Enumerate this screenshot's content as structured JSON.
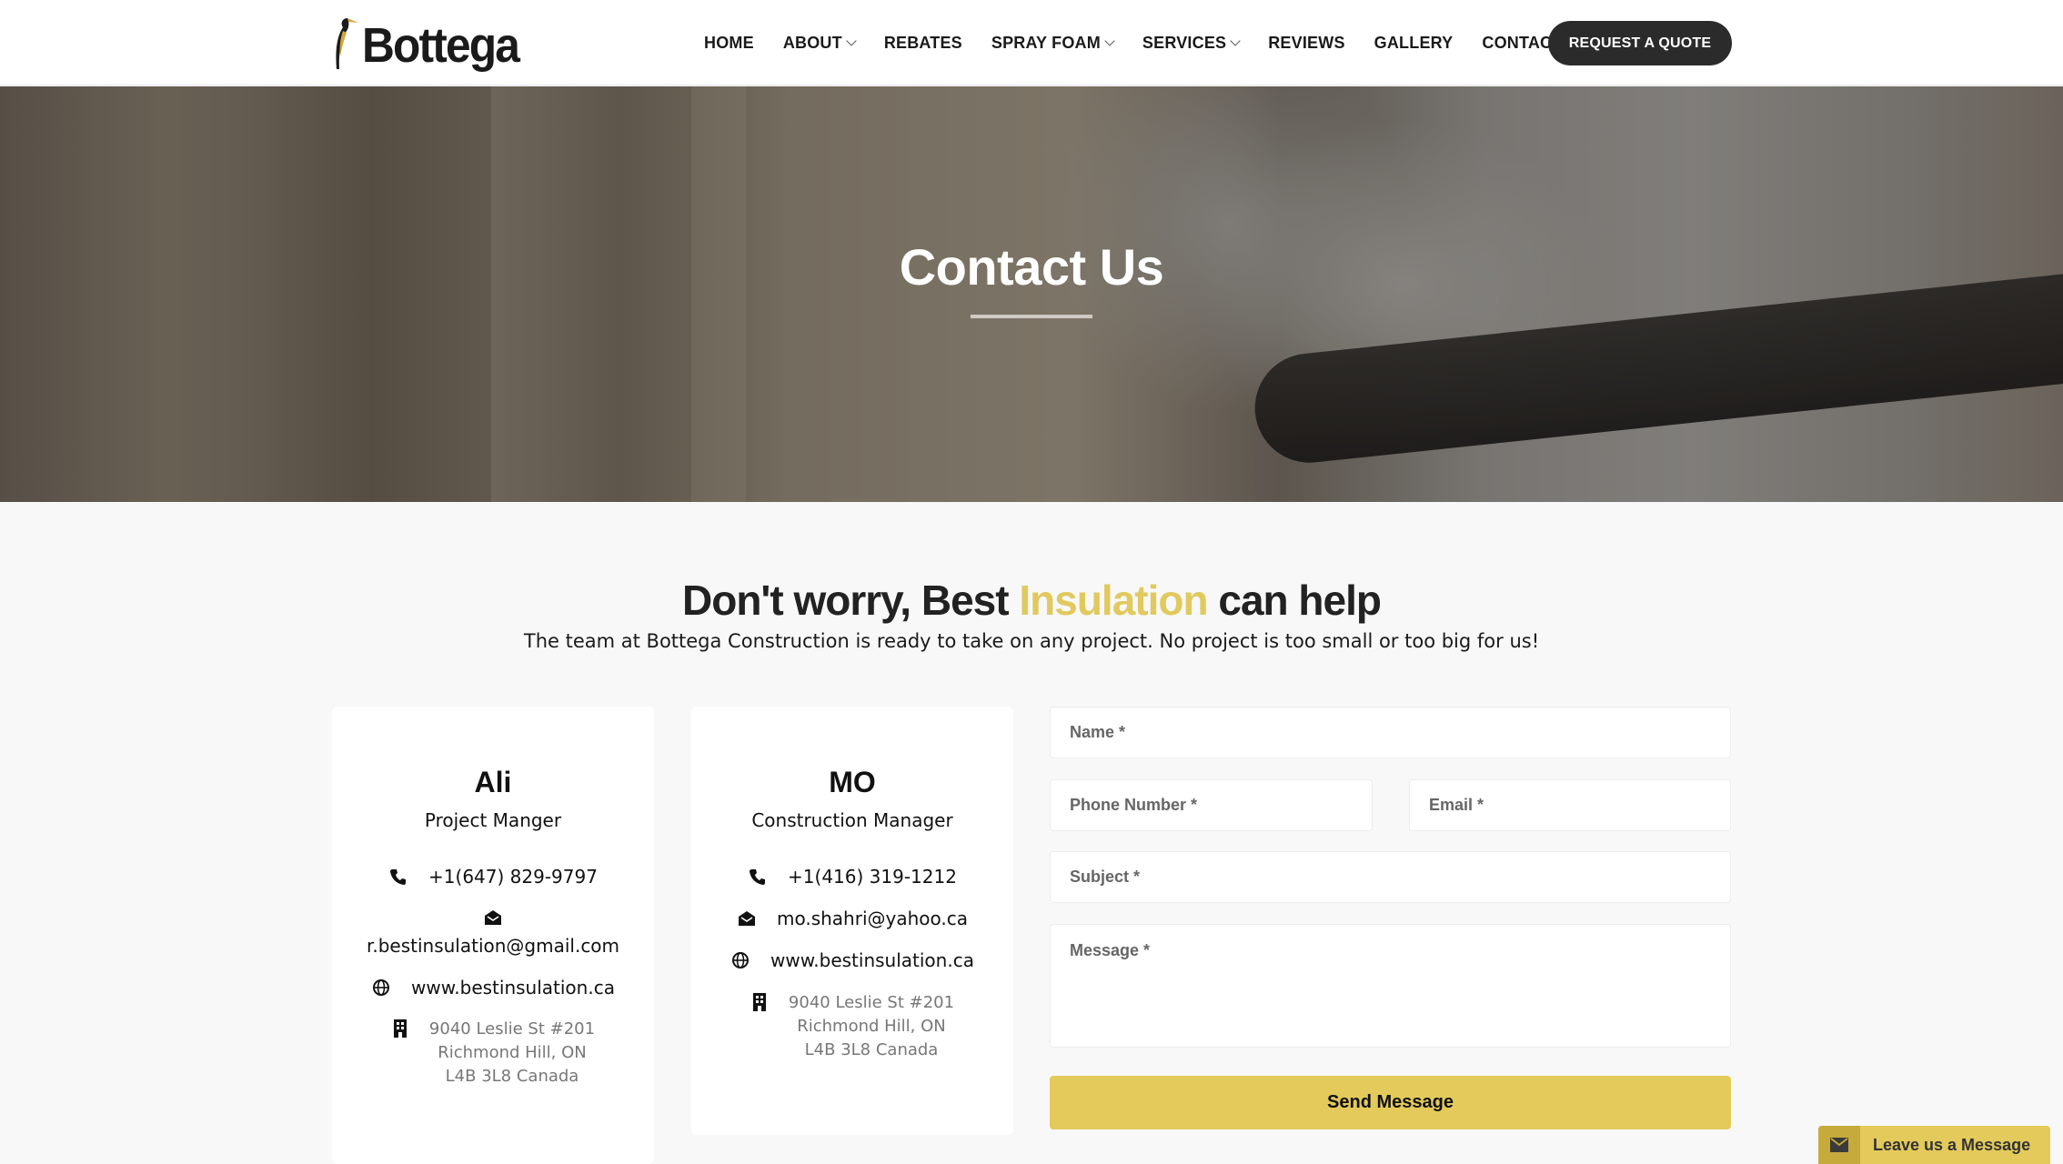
{
  "brand": {
    "logo_text": "Bottega"
  },
  "nav": {
    "items": [
      {
        "label": "HOME",
        "dropdown": false
      },
      {
        "label": "ABOUT",
        "dropdown": true
      },
      {
        "label": "REBATES",
        "dropdown": false
      },
      {
        "label": "SPRAY FOAM",
        "dropdown": true
      },
      {
        "label": "SERVICES",
        "dropdown": true
      },
      {
        "label": "REVIEWS",
        "dropdown": false
      },
      {
        "label": "GALLERY",
        "dropdown": false
      },
      {
        "label": "CONTACT",
        "dropdown": false
      }
    ],
    "cta_label": "REQUEST A QUOTE"
  },
  "hero": {
    "title": "Contact Us"
  },
  "intro": {
    "title_before": "Don't worry, Best ",
    "title_accent": "Insulation",
    "title_after": " can help",
    "subtitle": "The team at Bottega Construction is ready to take on any project. No project is too small or too big for us!"
  },
  "contacts": [
    {
      "name": "Ali",
      "role": "Project Manger",
      "phone": "+1(647) 829-9797",
      "email": "r.bestinsulation@gmail.com",
      "website": "www.bestinsulation.ca",
      "address_line1": "9040 Leslie St #201",
      "address_line2": "Richmond Hill, ON",
      "address_line3": "L4B 3L8 Canada"
    },
    {
      "name": "MO",
      "role": "Construction Manager",
      "phone": "+1(416) 319-1212",
      "email": "mo.shahri@yahoo.ca",
      "website": "www.bestinsulation.ca",
      "address_line1": "9040 Leslie St #201",
      "address_line2": "Richmond Hill, ON",
      "address_line3": "L4B 3L8 Canada"
    }
  ],
  "form": {
    "name_placeholder": "Name *",
    "phone_placeholder": "Phone Number *",
    "email_placeholder": "Email *",
    "subject_placeholder": "Subject *",
    "message_placeholder": "Message *",
    "submit_label": "Send Message"
  },
  "chat_widget": {
    "label": "Leave us a Message"
  },
  "colors": {
    "accent": "#e3ca5b",
    "dark_button": "#2b2b2b",
    "page_bg": "#f8f8f8"
  }
}
